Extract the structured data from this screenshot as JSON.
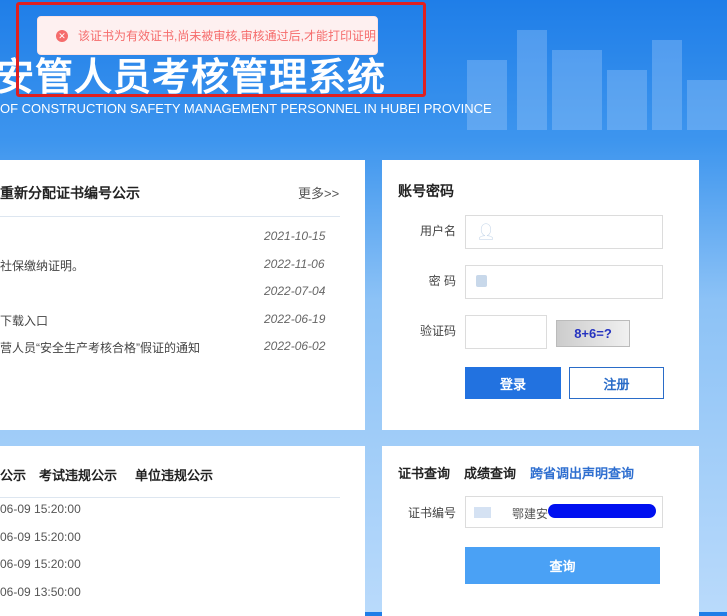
{
  "header": {
    "title": "安管人员考核管理系统",
    "subtitle": "OF CONSTRUCTION SAFETY MANAGEMENT PERSONNEL IN HUBEI PROVINCE"
  },
  "toast": {
    "message": "该证书为有效证书,尚未被审核,审核通过后,才能打印证明",
    "icon": "error-circle-icon"
  },
  "news": {
    "title": "重新分配证书编号公示",
    "more": "更多>>",
    "items": [
      {
        "title": "",
        "date": "2021-10-15"
      },
      {
        "title": "社保缴纳证明。",
        "date": "2022-11-06"
      },
      {
        "title": "",
        "date": "2022-07-04"
      },
      {
        "title": "下载入口",
        "date": "2022-06-19"
      },
      {
        "title": "营人员“安全生产考核合格”假证的通知",
        "date": "2022-06-02"
      }
    ]
  },
  "login": {
    "title": "账号密码",
    "username_label": "用户名",
    "password_label": "密 码",
    "captcha_label": "验证码",
    "captcha_text": "8+6=?",
    "login": "登录",
    "register": "注册"
  },
  "notices": {
    "tabs": [
      "公示",
      "考试违规公示",
      "单位违规公示"
    ],
    "items": [
      "06-09 15:20:00",
      "06-09 15:20:00",
      "06-09 15:20:00",
      "06-09 13:50:00"
    ]
  },
  "query": {
    "tabs": [
      "证书查询",
      "成绩查询",
      "跨省调出声明查询"
    ],
    "cert_label": "证书编号",
    "cert_value": "鄂建安",
    "submit": "查询"
  }
}
